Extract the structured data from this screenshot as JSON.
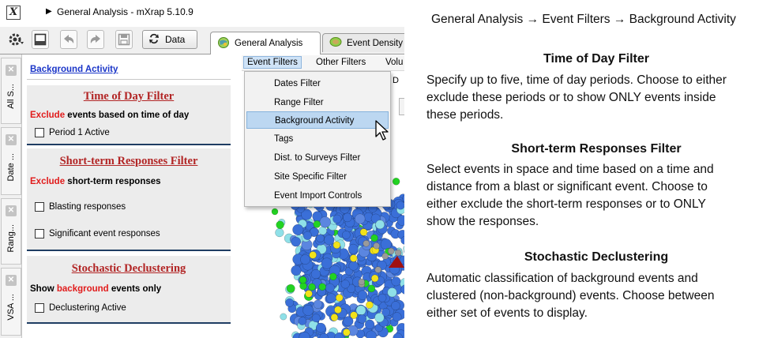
{
  "window": {
    "title": "General Analysis - mXrap 5.10.9",
    "title_arrow": "▶"
  },
  "toolbar": {
    "data_label": "Data",
    "icons": [
      "gear-icon",
      "window-icon",
      "undo-icon",
      "redo-icon",
      "save-icon",
      "refresh-icon"
    ]
  },
  "tabs": [
    {
      "label": "General Analysis",
      "icon": "globe-icon",
      "active": true
    },
    {
      "label": "Event Density",
      "icon": "density-icon",
      "active": false
    }
  ],
  "side_tabs": [
    {
      "label": "All S..."
    },
    {
      "label": "Date ..."
    },
    {
      "label": "Rang..."
    },
    {
      "label": "VSA ..."
    }
  ],
  "panel": {
    "link": "Background Activity",
    "time_of_day": {
      "title": "Time of Day Filter",
      "line_red": "Exclude",
      "line_rest": " events based on time of day",
      "checkbox": "Period 1 Active"
    },
    "short_term": {
      "title": "Short-term Responses Filter",
      "line_red": "Exclude",
      "line_rest": " short-term responses",
      "checkbox1": "Blasting responses",
      "checkbox2": "Significant event responses"
    },
    "declustering": {
      "title": "Stochastic Declustering",
      "line_pre": "Show ",
      "line_red": "background",
      "line_post": " events only",
      "checkbox": "Declustering Active"
    }
  },
  "menubar": {
    "items": [
      "Event Filters",
      "Other Filters",
      "Volu"
    ]
  },
  "dropdown": {
    "items": [
      "Dates Filter",
      "Range Filter",
      "Background Activity",
      "Tags",
      "Dist. to Surveys Filter",
      "Site Specific Filter",
      "Event Import Controls"
    ],
    "highlighted": "Background Activity"
  },
  "background_fragment": "D",
  "colors": {
    "section_title": "#b22525",
    "emphasis_red": "#e11b1b",
    "link_blue": "#1a35c8",
    "rule_navy": "#1f3d63",
    "menu_highlight": "#bcd7f1",
    "event_blue": "#3a6fd8",
    "event_cyan": "#8fe0e8",
    "event_green": "#22d322",
    "event_yellow": "#f2e21a",
    "event_marker_red": "#a01010"
  },
  "description": {
    "breadcrumb": "General Analysis → Event Filters → Background Activity",
    "sections": [
      {
        "heading": "Time of Day Filter",
        "lines": [
          "Specify up to five, time of day periods. Choose to either",
          "exclude these periods or to show ONLY events inside",
          "these periods."
        ]
      },
      {
        "heading": "Short-term Responses Filter",
        "lines": [
          "Select events in space and time based on a time and",
          "distance from a blast or significant event. Choose to",
          "either exclude the short-term responses or to ONLY",
          "show the responses."
        ]
      },
      {
        "heading": "Stochastic Declustering",
        "lines": [
          "Automatic classification of background events and",
          "clustered (non-background) events. Choose between",
          "either set of events to display."
        ]
      }
    ]
  }
}
